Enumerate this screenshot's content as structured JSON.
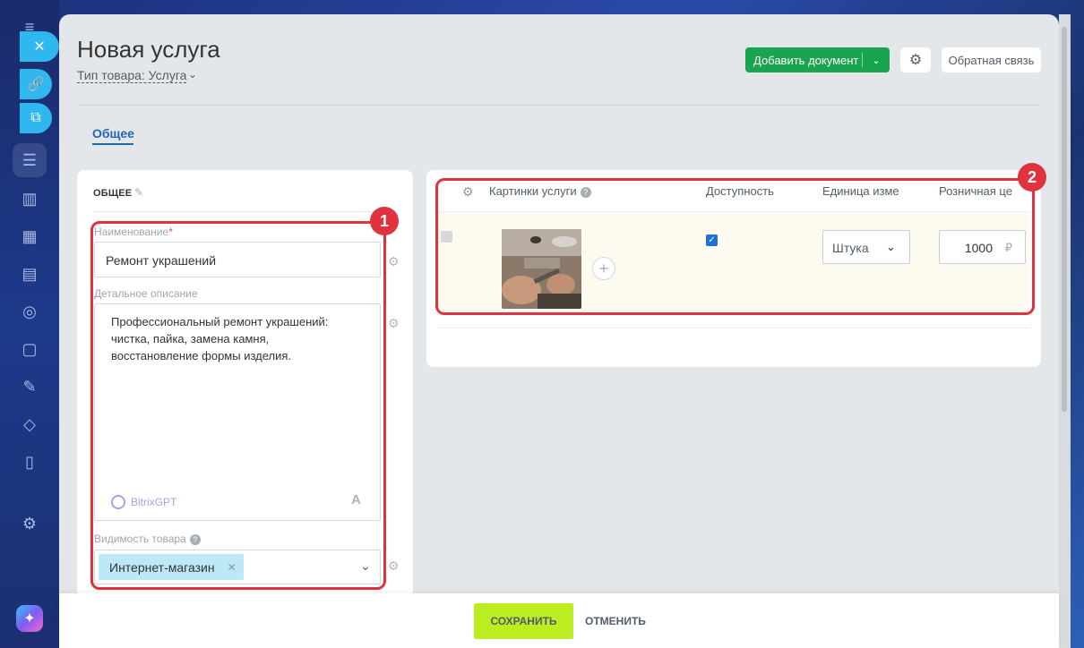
{
  "page": {
    "title": "Новая услуга",
    "type_label": "Тип товара: Услуга"
  },
  "toolbar": {
    "add_document": "Добавить документ",
    "feedback": "Обратная связь"
  },
  "tabs": [
    {
      "label": "Общее",
      "active": true
    }
  ],
  "general": {
    "section_title": "ОБЩЕЕ",
    "name_label": "Наименование",
    "name_required": "*",
    "name_value": "Ремонт украшений",
    "description_label": "Детальное описание",
    "description_value": "Профессиональный ремонт украшений:\nчистка, пайка, замена камня,\nвосстановление формы изделия.",
    "gpt_label": "BitrixGPT",
    "visibility_label": "Видимость товара",
    "visibility_tag": "Интернет-магазин"
  },
  "table": {
    "columns": [
      "Картинки услуги",
      "Доступность",
      "Единица изме",
      "Розничная це"
    ],
    "row": {
      "available": true,
      "unit": "Штука",
      "price": "1000",
      "currency": "₽"
    }
  },
  "badges": [
    "1",
    "2"
  ],
  "footer": {
    "save": "СОХРАНИТЬ",
    "cancel": "ОТМЕНИТЬ"
  },
  "colors": {
    "accent_green": "#19a44f",
    "save_lime": "#bbed21",
    "highlight_red": "#e0323f",
    "link_blue": "#2067b0"
  }
}
